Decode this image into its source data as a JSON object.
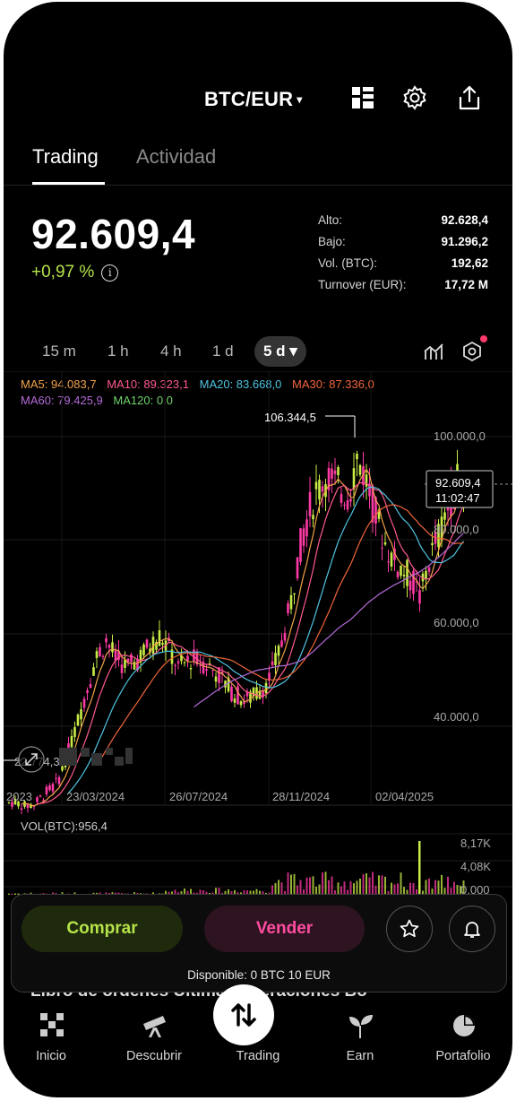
{
  "header": {
    "pair": "BTC/EUR",
    "caret": "▾"
  },
  "tabs": [
    {
      "label": "Trading"
    },
    {
      "label": "Actividad"
    }
  ],
  "ticker": {
    "price": "92.609,4",
    "change": "+0,97 %",
    "info_symbol": "i",
    "stats": [
      {
        "label": "Alto:",
        "value": "92.628,4"
      },
      {
        "label": "Bajo:",
        "value": "91.296,2"
      },
      {
        "label": "Vol. (BTC):",
        "value": "192,62"
      },
      {
        "label": "Turnover (EUR):",
        "value": "17,72 M"
      }
    ]
  },
  "intervals": [
    "15 m",
    "1 h",
    "4 h",
    "1 d",
    "5 d ▾"
  ],
  "selected_interval": "5 d",
  "indicators": {
    "row1": [
      {
        "text": "MA5: 94.083,7",
        "color": "#f2a24a"
      },
      {
        "text": "MA10: 89.323,1",
        "color": "#ff5a8c"
      },
      {
        "text": "MA20: 83.668,0",
        "color": "#4fc3e0"
      },
      {
        "text": "MA30: 87.336,0",
        "color": "#f0663a"
      }
    ],
    "row2": [
      {
        "text": "MA60: 79.425,9",
        "color": "#b46ad8"
      },
      {
        "text": "MA120: 0,0",
        "color": "#6fd36a"
      }
    ]
  },
  "chart_data": {
    "type": "candlestick",
    "y_ticks": [
      "100.000,0",
      "80.000,0",
      "60.000,0",
      "40.000,0"
    ],
    "x_ticks": [
      "2023",
      "23/03/2024",
      "26/07/2024",
      "28/11/2024",
      "02/04/2025"
    ],
    "high_label": "106.344,5",
    "low_label": "22.774,3",
    "current_price_label": "92.609,4",
    "countdown_label": "11:02:47",
    "ylim": [
      35000,
      110000
    ],
    "up_color": "#c8ec46",
    "down_color": "#ff3aa6"
  },
  "volume": {
    "label": "VOL(BTC):956,4",
    "ticks": [
      "8,17K",
      "4,08K",
      "0,000"
    ]
  },
  "actions": {
    "buy": "Comprar",
    "sell": "Vender",
    "available": "Disponible: 0 BTC  10 EUR"
  },
  "behind_tabs": "Libro de órdenes    Últimas operaciones    Bo",
  "nav": [
    {
      "label": "Inicio",
      "icon": "home-grid-icon"
    },
    {
      "label": "Descubrir",
      "icon": "telescope-icon"
    },
    {
      "label": "Trading",
      "icon": "swap-arrows-icon"
    },
    {
      "label": "Earn",
      "icon": "sprout-icon"
    },
    {
      "label": "Portafolio",
      "icon": "pie-chart-icon"
    }
  ]
}
